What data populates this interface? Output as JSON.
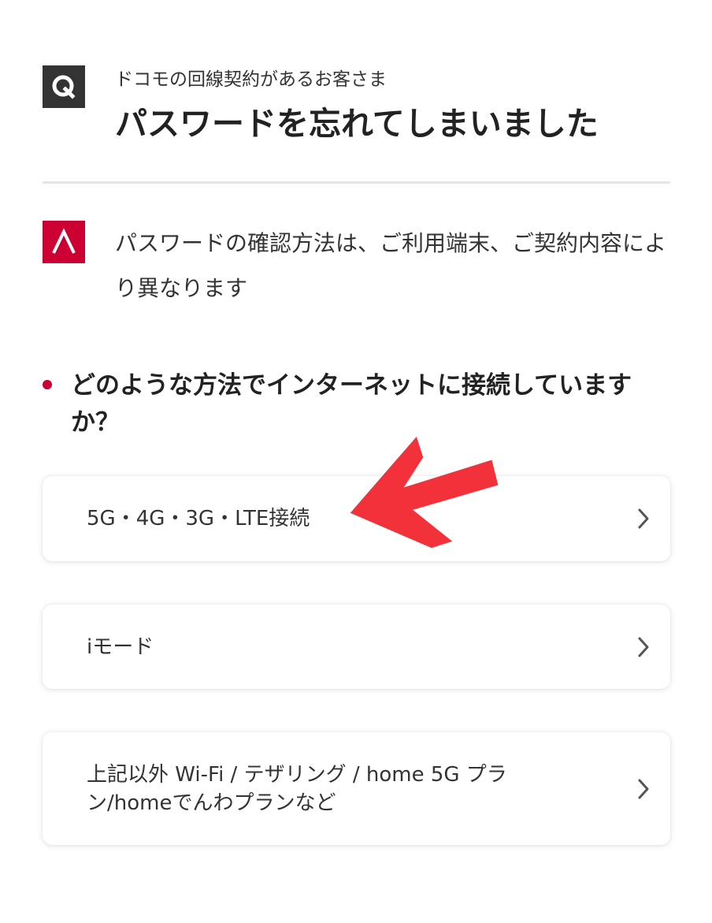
{
  "faq": {
    "question_badge": "Q",
    "subtitle": "ドコモの回線契約があるお客さま",
    "title": "パスワードを忘れてしまいました",
    "answer_badge": "A",
    "answer_text": "パスワードの確認方法は、ご利用端末、ご契約内容により異なります"
  },
  "section": {
    "heading": "どのような方法でインターネットに接続していますか？"
  },
  "options": [
    {
      "label": "5G・4G・3G・LTE接続",
      "icon": "chevron-right-icon"
    },
    {
      "label": "iモード",
      "icon": "chevron-right-icon"
    },
    {
      "label": "上記以外 Wi-Fi / テザリング / home 5G プラン/homeでんわプランなど",
      "icon": "chevron-right-icon"
    }
  ],
  "annotation": {
    "icon": "red-arrow-icon",
    "color": "#f2313b"
  },
  "colors": {
    "question_badge": "#333333",
    "answer_badge": "#cc0033",
    "bullet": "#cc0033",
    "divider": "#e6e6e6"
  }
}
